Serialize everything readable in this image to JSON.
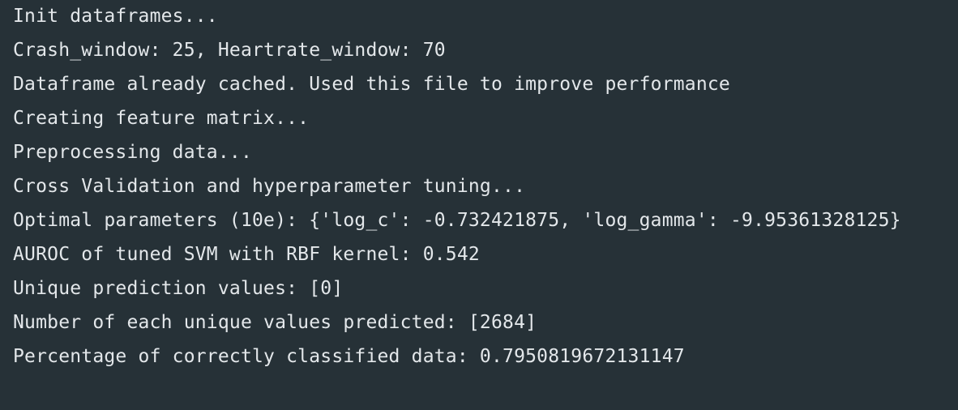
{
  "theme": {
    "background": "#263137",
    "text_color": "#e3e7ea"
  },
  "output_lines": [
    "Init dataframes...",
    "Crash_window: 25, Heartrate_window: 70",
    "Dataframe already cached. Used this file to improve performance",
    "Creating feature matrix...",
    "Preprocessing data...",
    "Cross Validation and hyperparameter tuning...",
    "Optimal parameters (10e): {'log_c': -0.732421875, 'log_gamma': -9.95361328125}",
    "AUROC of tuned SVM with RBF kernel: 0.542",
    "Unique prediction values: [0]",
    "Number of each unique values predicted: [2684]",
    "Percentage of correctly classified data: 0.7950819672131147"
  ]
}
